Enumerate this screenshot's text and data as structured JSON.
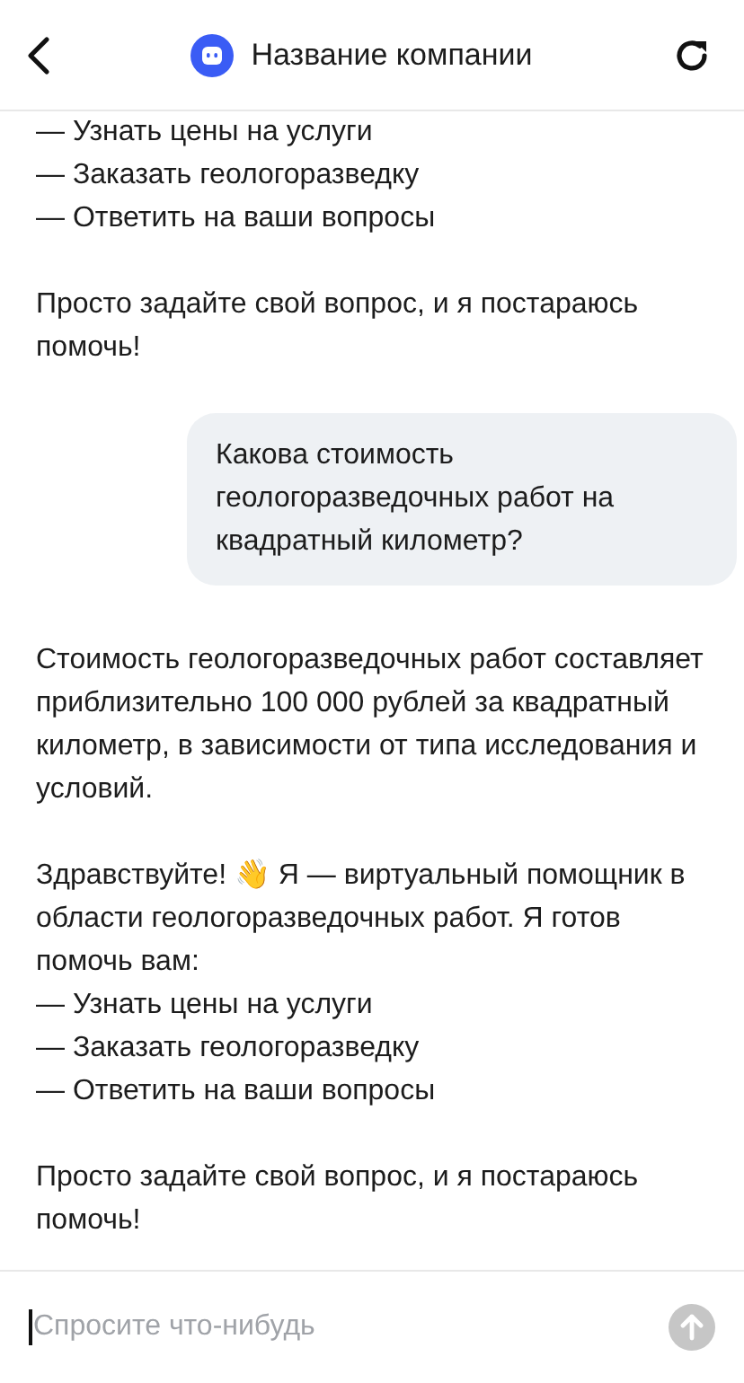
{
  "header": {
    "title": "Название компании"
  },
  "messages": [
    {
      "kind": "bot",
      "paragraphs": [
        [
          "— Узнать цены на услуги",
          "— Заказать геологоразведку",
          "— Ответить на ваши вопросы"
        ],
        [
          "Просто задайте свой вопрос, и я постараюсь помочь!"
        ]
      ]
    },
    {
      "kind": "user",
      "paragraphs": [
        [
          "Какова стоимость геологоразведочных работ на квадратный километр?"
        ]
      ]
    },
    {
      "kind": "bot",
      "paragraphs": [
        [
          "Стоимость геологоразведочных работ составляет приблизительно 100 000 рублей за квадратный километр, в зависимости от типа исследования и условий."
        ],
        [
          "Здравствуйте! 👋 Я — виртуальный помощник в области геологоразведочных работ. Я готов помочь вам:",
          "— Узнать цены на услуги",
          "— Заказать геологоразведку",
          "— Ответить на ваши вопросы"
        ],
        [
          "Просто задайте свой вопрос, и я постараюсь помочь!"
        ]
      ]
    }
  ],
  "input": {
    "placeholder": "Спросите что-нибудь"
  }
}
